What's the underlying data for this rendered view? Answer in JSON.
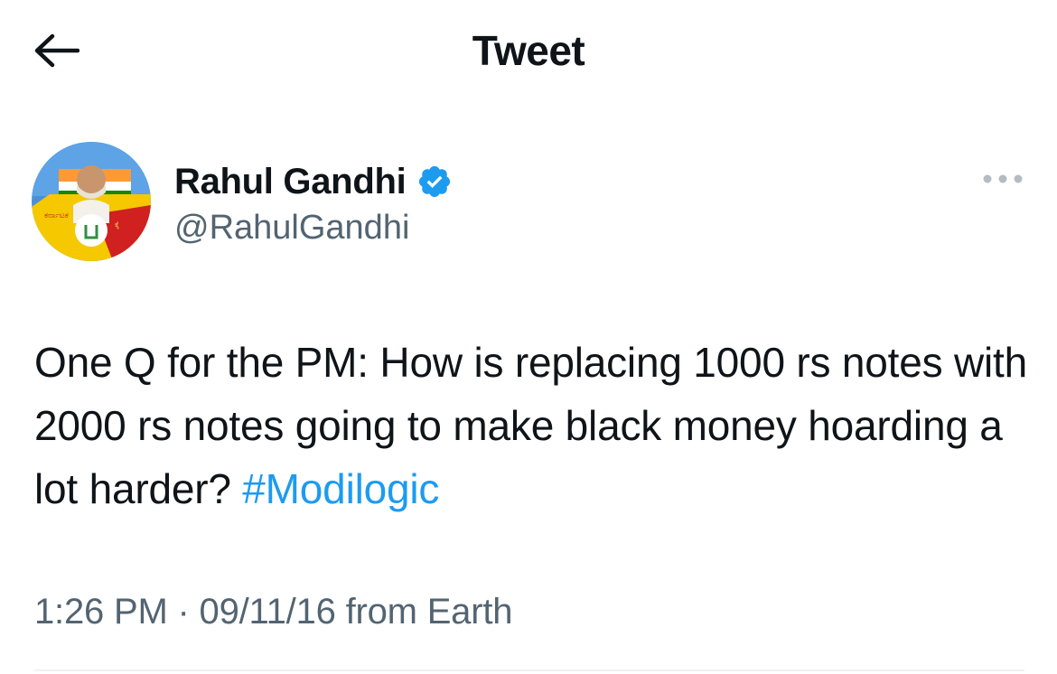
{
  "header": {
    "title": "Tweet",
    "back_icon": "arrow-left-icon"
  },
  "author": {
    "display_name": "Rahul Gandhi",
    "handle": "@RahulGandhi",
    "verified": true,
    "verified_color": "#1d9bf0",
    "avatar_icon": "profile-photo"
  },
  "tweet": {
    "text": "One Q for the PM: How is replacing 1000 rs notes with 2000 rs notes going to make black money hoarding a lot harder? ",
    "hashtag": "#Modilogic",
    "link_color": "#1d9bf0"
  },
  "meta": {
    "time": "1:26 PM",
    "separator": " · ",
    "date": "09/11/16",
    "source": " from Earth"
  },
  "more_icon": "more-horizontal-icon"
}
